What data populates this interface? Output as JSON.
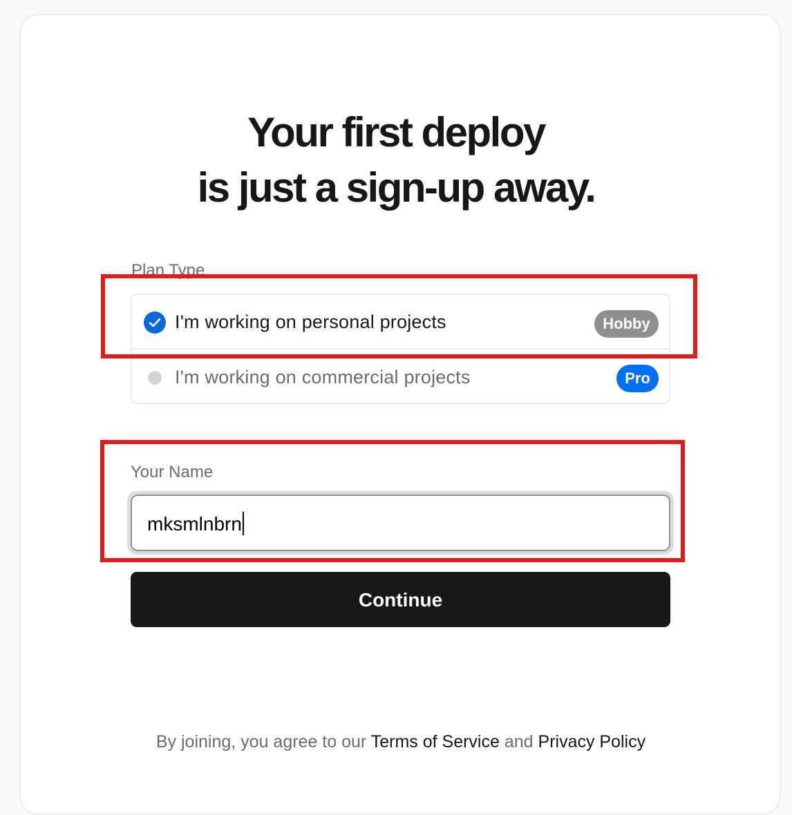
{
  "headline": {
    "line1": "Your first deploy",
    "line2": "is just a sign-up away."
  },
  "plan": {
    "label": "Plan Type",
    "options": [
      {
        "text": "I'm working on personal projects",
        "badge": "Hobby",
        "selected": true
      },
      {
        "text": "I'm working on commercial projects",
        "badge": "Pro",
        "selected": false
      }
    ]
  },
  "name": {
    "label": "Your Name",
    "value": "mksmlnbrn"
  },
  "continue_label": "Continue",
  "legal": {
    "prefix": "By joining, you agree to our ",
    "terms": "Terms of Service",
    "middle": " and ",
    "privacy": "Privacy Policy"
  },
  "colors": {
    "accent_blue": "#0a68d8",
    "pro_badge": "#0070f3",
    "hobby_badge": "#8f8f8f",
    "button_bg": "#171717",
    "highlight_red": "#e21b1b"
  }
}
